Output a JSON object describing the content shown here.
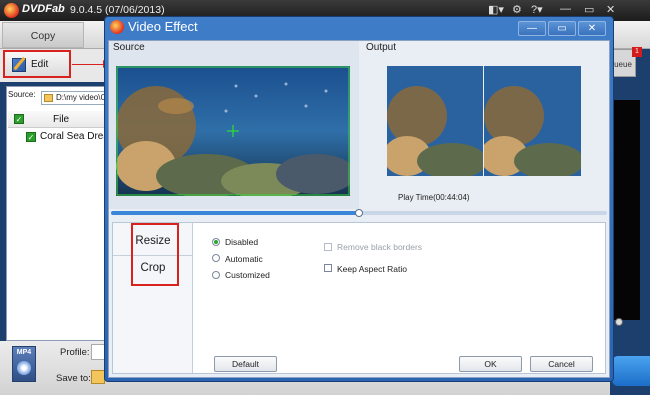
{
  "app": {
    "name": "DVDFab",
    "version": "9.0.4.5 (07/06/2013)",
    "toolbar": {
      "copy_tab": "Copy",
      "edit_button": "Edit",
      "queue_tab": "ueue",
      "queue_badge": "1"
    },
    "source_label": "Source:",
    "source_path": "D:\\my video\\C",
    "file_header": "File",
    "file_item": "Coral Sea Drea...",
    "profile_label": "Profile:",
    "saveto_label": "Save to:",
    "format_icon_label": "MP4"
  },
  "dialog": {
    "title": "Video Effect",
    "source_label": "Source",
    "output_label": "Output",
    "play_time": "Play Time(00:44:04)",
    "seek_progress": 0.5,
    "menu": [
      "Resize",
      "Crop"
    ],
    "options": {
      "disabled": "Disabled",
      "automatic": "Automatic",
      "customized": "Customized",
      "remove_black_borders": "Remove black borders",
      "keep_aspect_ratio": "Keep Aspect Ratio",
      "selected_mode": "Disabled"
    },
    "buttons": {
      "default": "Default",
      "ok": "OK",
      "cancel": "Cancel"
    }
  },
  "colors": {
    "accent_blue": "#2a64b0",
    "highlight_red": "#d9221d",
    "radio_on": "#2ca62c"
  }
}
